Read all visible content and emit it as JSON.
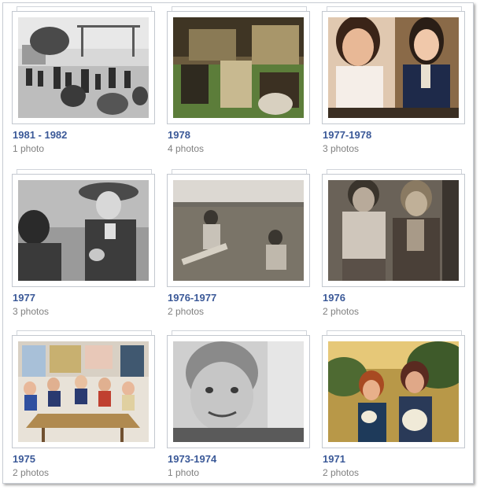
{
  "albums": [
    {
      "title": "1981 - 1982",
      "count": "1 photo"
    },
    {
      "title": "1978",
      "count": "4 photos"
    },
    {
      "title": "1977-1978",
      "count": "3 photos"
    },
    {
      "title": "1977",
      "count": "3 photos"
    },
    {
      "title": "1976-1977",
      "count": "2 photos"
    },
    {
      "title": "1976",
      "count": "2 photos"
    },
    {
      "title": "1975",
      "count": "2 photos"
    },
    {
      "title": "1973-1974",
      "count": "1 photo"
    },
    {
      "title": "1971",
      "count": "2 photos"
    }
  ],
  "colors": {
    "link": "#3b5998",
    "meta": "#808080",
    "border": "#c3c8cf"
  }
}
